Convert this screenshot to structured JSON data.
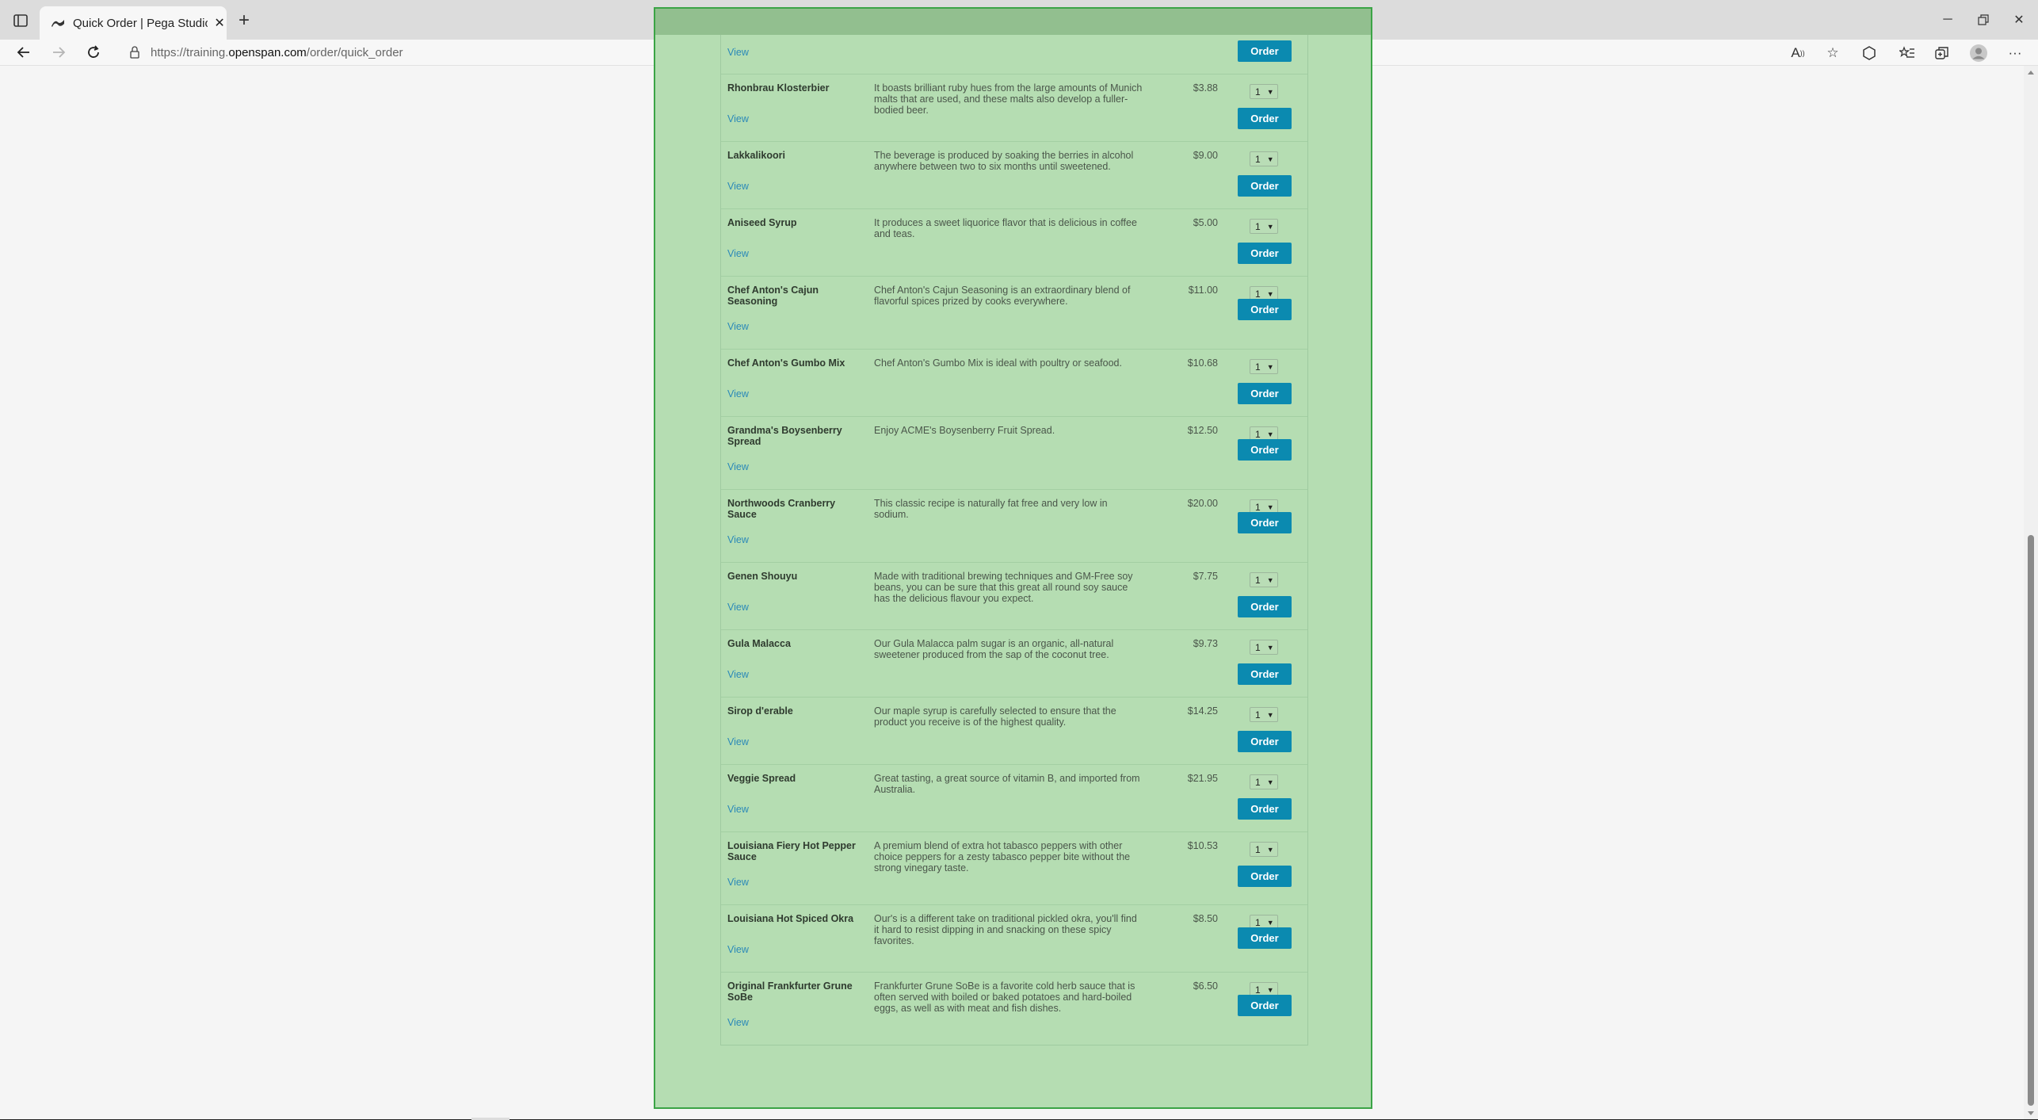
{
  "browser": {
    "tab_title": "Quick Order | Pega Studio Traini",
    "url_prefix": "https://training.",
    "url_host": "openspan.com",
    "url_path": "/order/quick_order",
    "icons": [
      "tab-actions-icon",
      "pega-favicon-icon",
      "close-icon",
      "plus-icon",
      "minimize-icon",
      "restore-icon",
      "close-window-icon",
      "back-arrow-icon",
      "forward-arrow-icon",
      "refresh-icon",
      "lock-icon",
      "read-aloud-icon",
      "favorite-add-icon",
      "extensions-icon",
      "favorites-icon",
      "collections-icon",
      "profile-icon",
      "more-icon"
    ]
  },
  "top_row": {
    "view_label": "View",
    "order_label": "Order"
  },
  "products": [
    {
      "name": "Rhonbrau Klosterbier",
      "description": "It boasts brilliant ruby hues from the large amounts of Munich malts that are used, and these malts also develop a fuller-bodied beer.",
      "price": "$3.88",
      "qty": "1",
      "view_label": "View",
      "order_label": "Order"
    },
    {
      "name": "Lakkalikoori",
      "description": "The beverage is produced by soaking the berries in alcohol anywhere between two to six months until sweetened.",
      "price": "$9.00",
      "qty": "1",
      "view_label": "View",
      "order_label": "Order"
    },
    {
      "name": "Aniseed Syrup",
      "description": "It produces a sweet liquorice flavor that is delicious in coffee and teas.",
      "price": "$5.00",
      "qty": "1",
      "view_label": "View",
      "order_label": "Order"
    },
    {
      "name": "Chef Anton's Cajun Seasoning",
      "description": "Chef Anton's Cajun Seasoning is an extraordinary blend of flavorful spices prized by cooks everywhere.",
      "price": "$11.00",
      "qty": "1",
      "view_label": "View",
      "order_label": "Order"
    },
    {
      "name": "Chef Anton's Gumbo Mix",
      "description": "Chef Anton's Gumbo Mix is ideal with poultry or seafood.",
      "price": "$10.68",
      "qty": "1",
      "view_label": "View",
      "order_label": "Order"
    },
    {
      "name": "Grandma's Boysenberry Spread",
      "description": "Enjoy ACME's Boysenberry Fruit Spread.",
      "price": "$12.50",
      "qty": "1",
      "view_label": "View",
      "order_label": "Order"
    },
    {
      "name": "Northwoods Cranberry Sauce",
      "description": "This classic recipe is naturally fat free and very low in sodium.",
      "price": "$20.00",
      "qty": "1",
      "view_label": "View",
      "order_label": "Order"
    },
    {
      "name": "Genen Shouyu",
      "description": "Made with traditional brewing techniques and GM-Free soy beans, you can be sure that this great all round soy sauce has the delicious flavour you expect.",
      "price": "$7.75",
      "qty": "1",
      "view_label": "View",
      "order_label": "Order"
    },
    {
      "name": "Gula Malacca",
      "description": "Our Gula Malacca palm sugar is an organic, all-natural sweetener produced from the sap of the coconut tree.",
      "price": "$9.73",
      "qty": "1",
      "view_label": "View",
      "order_label": "Order"
    },
    {
      "name": "Sirop d'erable",
      "description": "Our maple syrup is carefully selected to ensure that the product you receive is of the highest quality.",
      "price": "$14.25",
      "qty": "1",
      "view_label": "View",
      "order_label": "Order"
    },
    {
      "name": "Veggie Spread",
      "description": "Great tasting, a great source of vitamin B, and imported from Australia.",
      "price": "$21.95",
      "qty": "1",
      "view_label": "View",
      "order_label": "Order"
    },
    {
      "name": "Louisiana Fiery Hot Pepper Sauce",
      "description": "A premium blend of extra hot tabasco peppers with other choice peppers for a zesty tabasco pepper bite without the strong vinegary taste.",
      "price": "$10.53",
      "qty": "1",
      "view_label": "View",
      "order_label": "Order"
    },
    {
      "name": "Louisiana Hot Spiced Okra",
      "description": "Our's is a different take on traditional pickled okra, you'll find it hard to resist dipping in and snacking on these spicy favorites.",
      "price": "$8.50",
      "qty": "1",
      "view_label": "View",
      "order_label": "Order"
    },
    {
      "name": "Original Frankfurter Grune SoBe",
      "description": "Frankfurter Grune SoBe is a favorite cold herb sauce that is often served with boiled or baked potatoes and hard-boiled eggs, as well as with meat and fish dishes.",
      "price": "$6.50",
      "qty": "1",
      "view_label": "View",
      "order_label": "Order"
    }
  ],
  "colors": {
    "highlight_fill": "#b5ddb2",
    "highlight_border": "#3ba446",
    "order_button": "#0b8ab0",
    "link": "#2b89b8"
  }
}
